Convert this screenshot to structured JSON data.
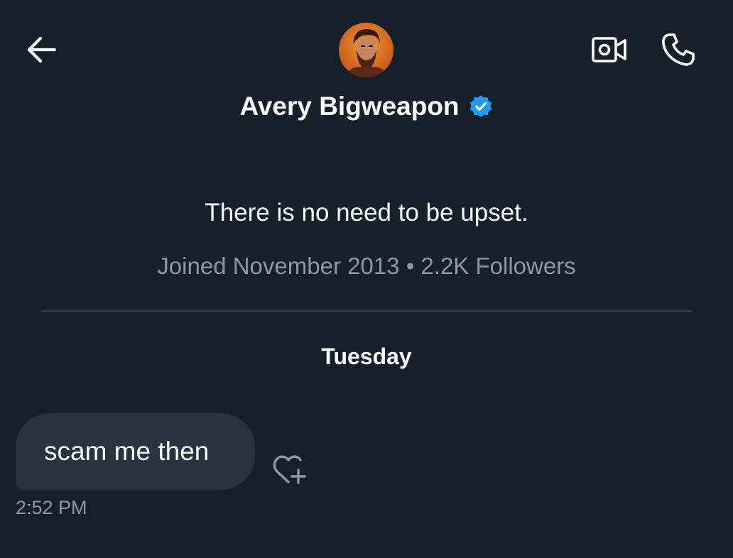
{
  "header": {
    "back_icon": "arrow-left-icon",
    "video_icon": "video-call-icon",
    "phone_icon": "phone-icon",
    "avatar_icon": "user-avatar"
  },
  "profile": {
    "display_name": "Avery Bigweapon",
    "verified_icon": "verified-badge-icon",
    "bio": "There is no need to be upset.",
    "joined": "Joined November 2013",
    "separator": "•",
    "followers": "2.2K Followers"
  },
  "conversation": {
    "day_label": "Tuesday",
    "messages": [
      {
        "text": "scam me then",
        "time": "2:52 PM",
        "react_icon": "add-reaction-heart-icon"
      }
    ]
  },
  "colors": {
    "background": "#15202b",
    "bubble": "#283340",
    "secondary_text": "#8b98a5",
    "verified": "#1d9bf0",
    "divider": "#38444d"
  }
}
